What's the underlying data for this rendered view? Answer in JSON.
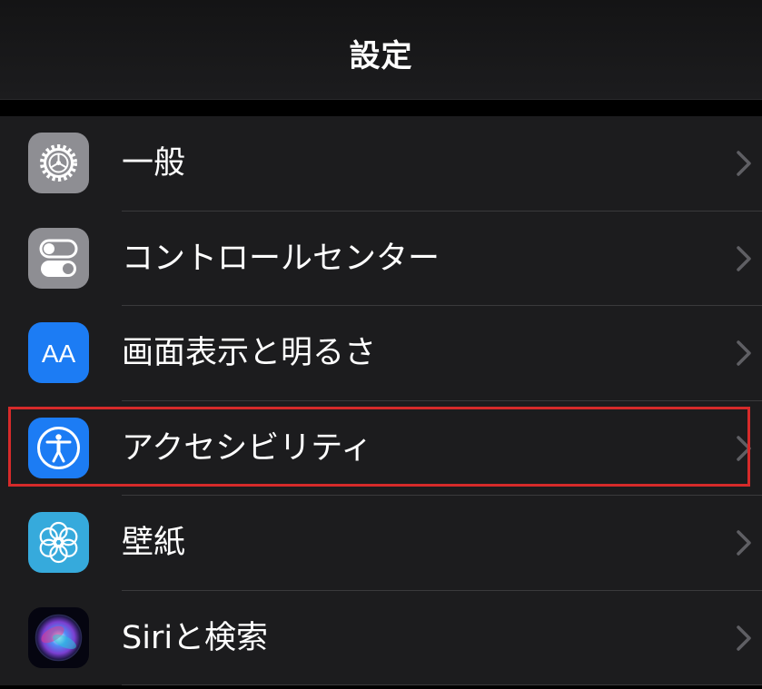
{
  "nav": {
    "title": "設定"
  },
  "rows": [
    {
      "label": "一般",
      "icon": "gear-icon",
      "icon_bg": "#8e8e93"
    },
    {
      "label": "コントロールセンター",
      "icon": "toggles-icon",
      "icon_bg": "#8e8e93"
    },
    {
      "label": "画面表示と明るさ",
      "icon": "text-size-icon",
      "icon_bg": "#1c7cf4",
      "icon_text": "AA"
    },
    {
      "label": "アクセシビリティ",
      "icon": "accessibility-icon",
      "icon_bg": "#1c7cf4"
    },
    {
      "label": "壁紙",
      "icon": "flower-icon",
      "icon_bg": "#36aadc"
    },
    {
      "label": "Siriと検索",
      "icon": "siri-icon",
      "icon_bg": "#000000"
    }
  ],
  "highlight_color": "#d62a2a"
}
